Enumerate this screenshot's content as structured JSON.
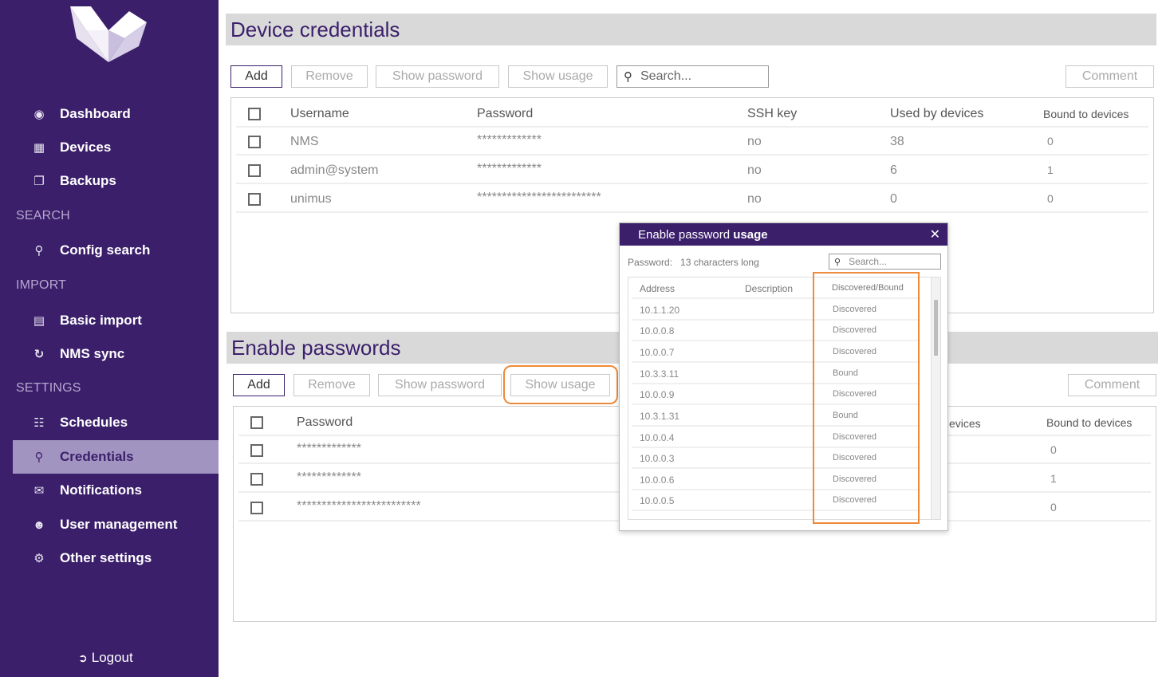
{
  "sidebar": {
    "items": [
      {
        "label": "Dashboard",
        "icon": "dashboard-icon"
      },
      {
        "label": "Devices",
        "icon": "grid-icon"
      },
      {
        "label": "Backups",
        "icon": "copy-icon"
      },
      {
        "label": "Config search",
        "icon": "search-icon"
      },
      {
        "label": "Basic import",
        "icon": "file-icon"
      },
      {
        "label": "NMS sync",
        "icon": "sync-icon"
      },
      {
        "label": "Schedules",
        "icon": "calendar-icon"
      },
      {
        "label": "Credentials",
        "icon": "key-icon"
      },
      {
        "label": "Notifications",
        "icon": "envelope-icon"
      },
      {
        "label": "User management",
        "icon": "users-icon"
      },
      {
        "label": "Other settings",
        "icon": "gears-icon"
      }
    ],
    "sections": {
      "search": "SEARCH",
      "import": "IMPORT",
      "settings": "SETTINGS"
    },
    "logout": "Logout",
    "active": "Credentials"
  },
  "device_credentials": {
    "title": "Device credentials",
    "buttons": {
      "add": "Add",
      "remove": "Remove",
      "show_password": "Show password",
      "show_usage": "Show usage",
      "comment": "Comment"
    },
    "search_placeholder": "Search...",
    "columns": [
      "Username",
      "Password",
      "SSH key",
      "Used by devices",
      "Bound to devices"
    ],
    "rows": [
      {
        "username": "NMS",
        "password": "*************",
        "ssh": "no",
        "used": "38",
        "bound": "0"
      },
      {
        "username": "admin@system",
        "password": "*************",
        "ssh": "no",
        "used": "6",
        "bound": "1"
      },
      {
        "username": "unimus",
        "password": "*************************",
        "ssh": "no",
        "used": "0",
        "bound": "0"
      }
    ]
  },
  "enable_passwords": {
    "title": "Enable passwords",
    "buttons": {
      "add": "Add",
      "remove": "Remove",
      "show_password": "Show password",
      "show_usage": "Show usage",
      "comment": "Comment"
    },
    "columns": {
      "password": "Password",
      "used_partial": "evices",
      "bound": "Bound to devices"
    },
    "rows": [
      {
        "password": "*************",
        "bound": "0"
      },
      {
        "password": "*************",
        "bound": "1"
      },
      {
        "password": "*************************",
        "bound": "0"
      }
    ]
  },
  "modal": {
    "title_prefix": "Enable password",
    "title_bold": "usage",
    "password_label": "Password:",
    "password_value": "13 characters long",
    "search_placeholder": "Search...",
    "columns": {
      "address": "Address",
      "description": "Description",
      "status": "Discovered/Bound"
    },
    "rows": [
      {
        "address": "10.1.1.20",
        "status": "Discovered"
      },
      {
        "address": "10.0.0.8",
        "status": "Discovered"
      },
      {
        "address": "10.0.0.7",
        "status": "Discovered"
      },
      {
        "address": "10.3.3.11",
        "status": "Bound"
      },
      {
        "address": "10.0.0.9",
        "status": "Discovered"
      },
      {
        "address": "10.3.1.31",
        "status": "Bound"
      },
      {
        "address": "10.0.0.4",
        "status": "Discovered"
      },
      {
        "address": "10.0.0.3",
        "status": "Discovered"
      },
      {
        "address": "10.0.0.6",
        "status": "Discovered"
      },
      {
        "address": "10.0.0.5",
        "status": "Discovered"
      }
    ]
  }
}
